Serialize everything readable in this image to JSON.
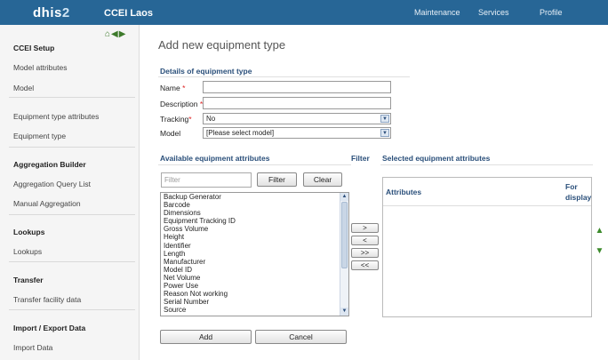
{
  "topbar": {
    "logo_main": "dhis",
    "logo_num": "2",
    "app_title": "CCEI Laos",
    "menu": [
      "Maintenance",
      "Services",
      "Profile"
    ]
  },
  "sidebar": {
    "icons": [
      "home-icon",
      "back-icon",
      "forward-icon"
    ],
    "groups": [
      {
        "title": "CCEI Setup",
        "items": [
          "Model attributes",
          "Model",
          "Equipment type attributes",
          "Equipment type"
        ]
      },
      {
        "title": "Aggregation Builder",
        "items": [
          "Aggregation Query List",
          "Manual Aggregation"
        ]
      },
      {
        "title": "Lookups",
        "items": [
          "Lookups"
        ]
      },
      {
        "title": "Transfer",
        "items": [
          "Transfer facility data"
        ]
      },
      {
        "title": "Import / Export Data",
        "items": [
          "Import Data"
        ]
      }
    ]
  },
  "main": {
    "page_title": "Add new equipment type",
    "details_title": "Details of equipment type",
    "fields": {
      "name_label": "Name",
      "description_label": "Description",
      "tracking_label": "Tracking",
      "tracking_value": "No",
      "model_label": "Model",
      "model_value": "[Please select model]",
      "name_value": "",
      "description_value": ""
    },
    "available_title": "Available equipment attributes",
    "filter_title": "Filter",
    "selected_title": "Selected equipment attributes",
    "filter_placeholder": "Filter",
    "filter_button": "Filter",
    "clear_button": "Clear",
    "available_items": [
      "Backup Generator",
      "Barcode",
      "Dimensions",
      "Equipment Tracking ID",
      "Gross Volume",
      "Height",
      "Identifier",
      "Length",
      "Manufacturer",
      "Model ID",
      "Net Volume",
      "Power Use",
      "Reason Not working",
      "Serial Number",
      "Source"
    ],
    "move_buttons": [
      ">",
      "<",
      ">>",
      "<<"
    ],
    "selected_headers": {
      "attributes": "Attributes",
      "for": "For",
      "display": "display"
    },
    "add_button": "Add",
    "cancel_button": "Cancel"
  },
  "colors": {
    "topbar": "#276696",
    "section_title": "#2a4f7a",
    "required": "#d22222",
    "arrow_green": "#3b8a2a"
  }
}
